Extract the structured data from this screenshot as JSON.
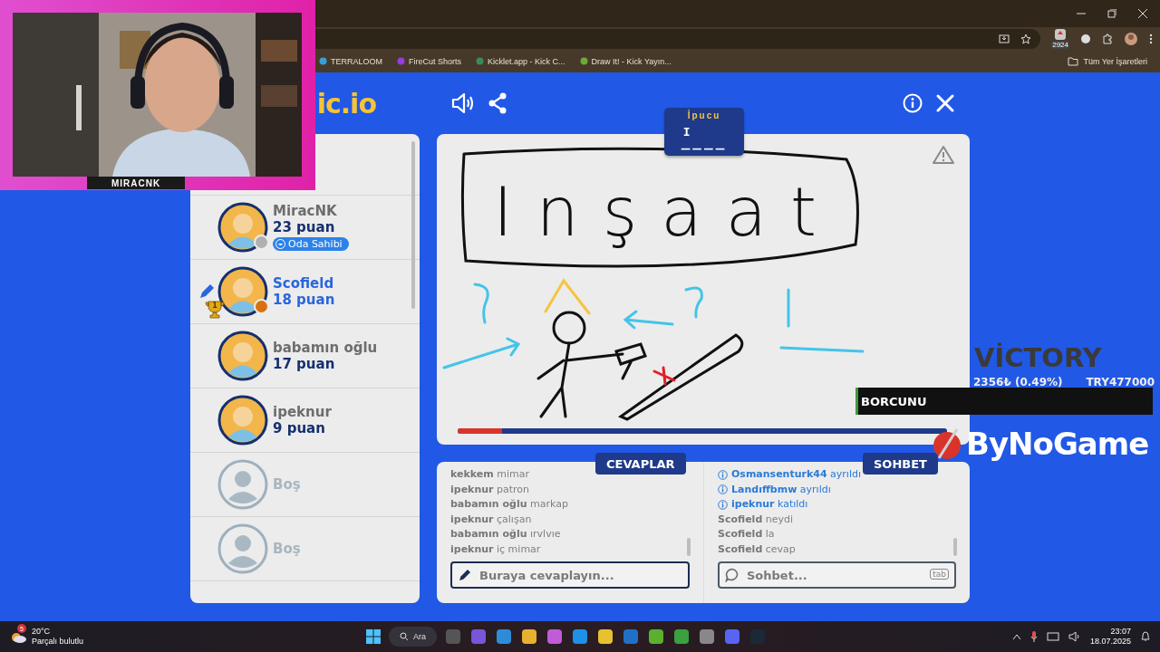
{
  "browser": {
    "bookmarks": [
      {
        "label": "TERRALOOM"
      },
      {
        "label": "FireCut Shorts"
      },
      {
        "label": "Kicklet.app - Kick C..."
      },
      {
        "label": "Draw It! - Kick Yayın..."
      }
    ],
    "all_bookmarks": "Tüm Yer İşaretleri",
    "extension_badge": "2924"
  },
  "webcam": {
    "kind": "picture",
    "label": "MIRACNK"
  },
  "game": {
    "logo": "ic.io",
    "hint": {
      "title": "İpucu",
      "letter": "I",
      "blanks": "____"
    },
    "players": [
      {
        "kind": "player",
        "name": "MiracNK",
        "score": "23 puan",
        "badge": "Oda Sahibi",
        "color": "#b0b0b0",
        "drawing": false
      },
      {
        "kind": "player",
        "name": "Scofield",
        "score": "18 puan",
        "rank": "1",
        "color": "#d9700f",
        "drawing": true
      },
      {
        "kind": "player",
        "name": "babamın oğlu",
        "score": "17 puan",
        "drawing": false
      },
      {
        "kind": "player",
        "name": "ipeknur",
        "score": "9 puan",
        "drawing": false
      },
      {
        "kind": "empty",
        "name": "Boş"
      },
      {
        "kind": "empty",
        "name": "Boş"
      }
    ],
    "canvas": {
      "word": "Inşaat",
      "timer": {
        "level": 0.09
      }
    },
    "answers": {
      "tab": "CEVAPLAR",
      "messages": [
        {
          "user": "kekkem",
          "text": "mimar"
        },
        {
          "user": "ipeknur",
          "text": "patron"
        },
        {
          "user": "babamın oğlu",
          "text": "markap"
        },
        {
          "user": "ipeknur",
          "text": "çalışan"
        },
        {
          "user": "babamın oğlu",
          "text": "ırvlvıe"
        },
        {
          "user": "ipeknur",
          "text": "iç mimar"
        }
      ],
      "placeholder": "Buraya cevaplayın..."
    },
    "chat": {
      "tab": "SOHBET",
      "messages": [
        {
          "kind": "system",
          "user": "Osmansenturk44",
          "text": "ayrıldı"
        },
        {
          "kind": "system",
          "user": "Landıffbmw",
          "text": "ayrıldı"
        },
        {
          "kind": "system",
          "user": "ipeknur",
          "text": "katıldı"
        },
        {
          "kind": "message",
          "user": "Scofield",
          "text": "neydi"
        },
        {
          "kind": "message",
          "user": "Scofield",
          "text": "la"
        },
        {
          "kind": "message",
          "user": "Scofield",
          "text": "cevap"
        }
      ],
      "placeholder": "Sohbet...",
      "key": "tab"
    }
  },
  "overlays": {
    "sponsor_1": "VİCTORY",
    "ticker": {
      "change": "2356₺ (0.49%)",
      "amount": "TRY477000",
      "headline": "BORCUNU"
    },
    "sponsor_2": "ByNoGame"
  },
  "taskbar": {
    "weather": {
      "badge": "5",
      "temp": "20°C",
      "text": "Parçalı bulutlu"
    },
    "search": "Ara",
    "time": "23:07",
    "date": "18.07.2025"
  }
}
